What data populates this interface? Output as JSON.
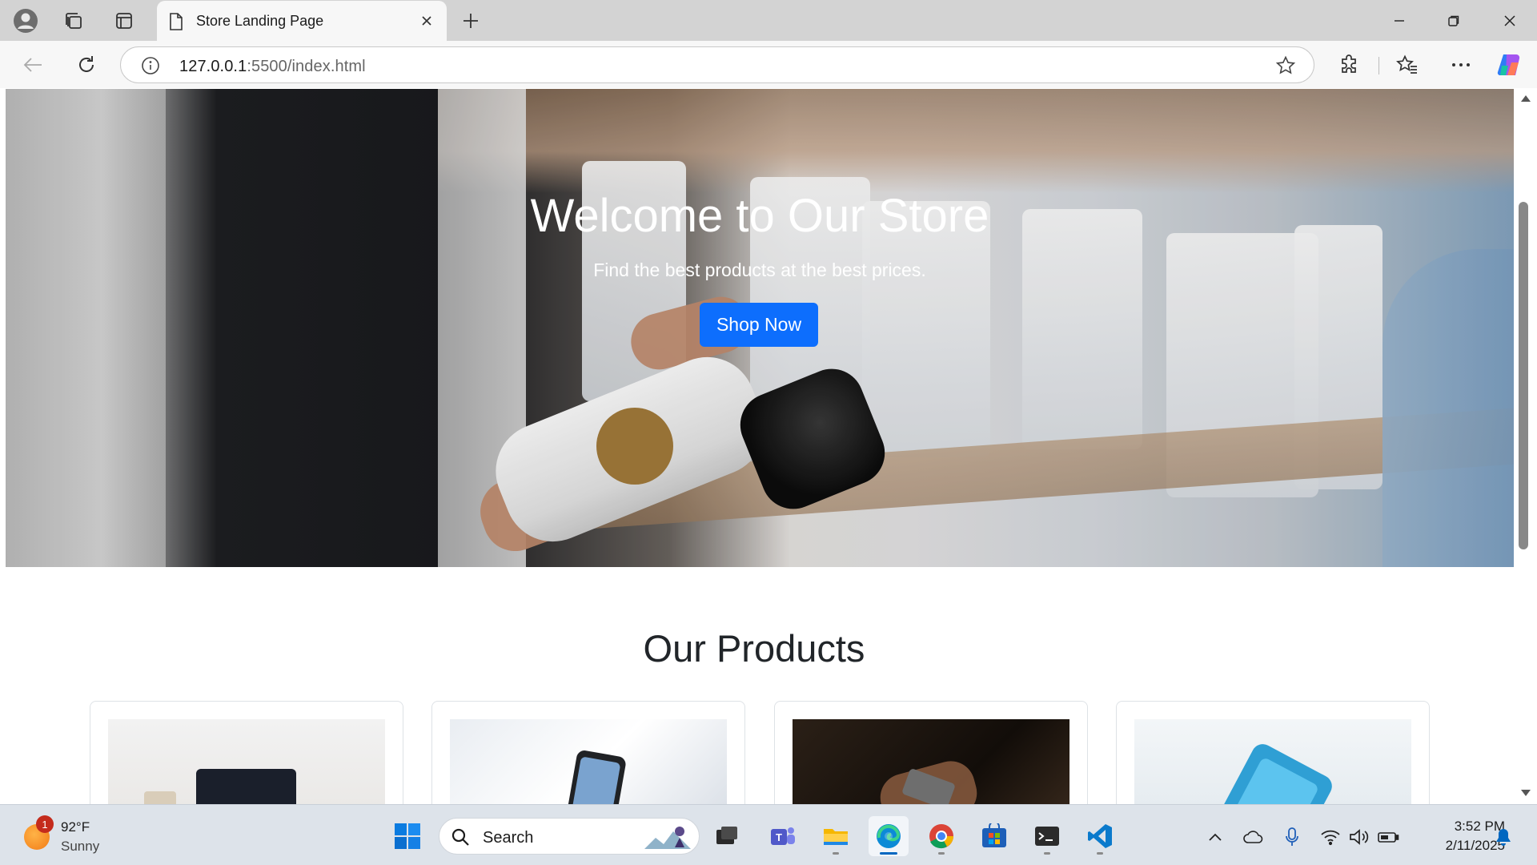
{
  "browser": {
    "tab_title": "Store Landing Page",
    "url_host": "127.0.0.1",
    "url_rest": ":5500/index.html"
  },
  "page": {
    "hero_title": "Welcome to Our Store",
    "hero_subtitle": "Find the best products at the best prices.",
    "hero_button": "Shop Now",
    "products_heading": "Our Products",
    "products": [
      {
        "image": "laptop-photo"
      },
      {
        "image": "phone-in-hand-photo"
      },
      {
        "image": "phone-dark-photo"
      },
      {
        "image": "smartphone-photo"
      }
    ]
  },
  "taskbar": {
    "weather_temp": "92°F",
    "weather_condition": "Sunny",
    "weather_badge": "1",
    "search_label": "Search",
    "time": "3:52 PM",
    "date": "2/11/2025"
  },
  "colors": {
    "primary_button": "#0d6efd",
    "accent": "#0067c0"
  }
}
